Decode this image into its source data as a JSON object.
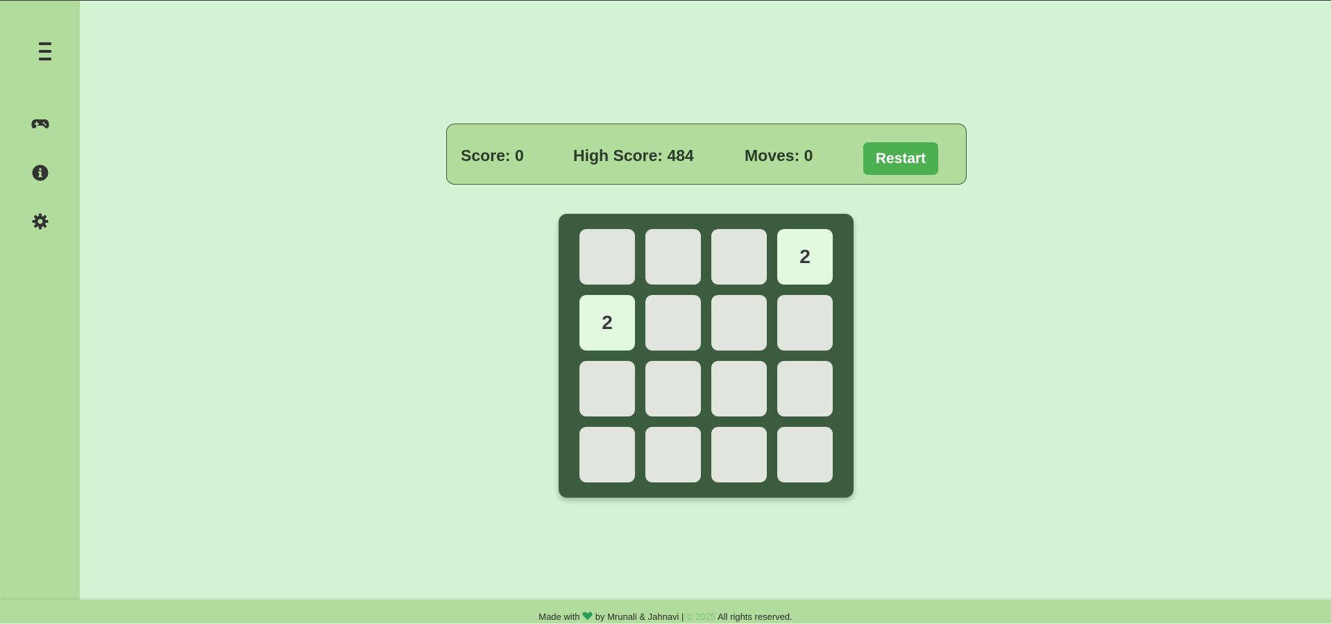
{
  "sidebar": {
    "items": [
      {
        "icon": "gamepad-icon"
      },
      {
        "icon": "info-icon"
      },
      {
        "icon": "gear-icon"
      }
    ]
  },
  "scorebar": {
    "score_label": "Score: 0",
    "high_score_label": "High Score: 484",
    "moves_label": "Moves: 0",
    "restart_label": "Restart"
  },
  "game": {
    "score": 0,
    "high_score": 484,
    "moves": 0,
    "grid_size": 4,
    "tiles": [
      [
        "",
        "",
        "",
        "2"
      ],
      [
        "2",
        "",
        "",
        ""
      ],
      [
        "",
        "",
        "",
        ""
      ],
      [
        "",
        "",
        "",
        ""
      ]
    ]
  },
  "footer": {
    "made_with": "Made with",
    "by": "by Mrunali & Jahnavi |",
    "copyright": "© 2025",
    "rights": "All rights reserved."
  },
  "colors": {
    "background": "#d3f5d4",
    "sidebar": "#b2dc9c",
    "board": "#3c5d40",
    "empty_tile": "#e1e5de",
    "tile_2": "#e2f8e0",
    "restart": "#4caf50",
    "heart": "#2e9e5b"
  }
}
